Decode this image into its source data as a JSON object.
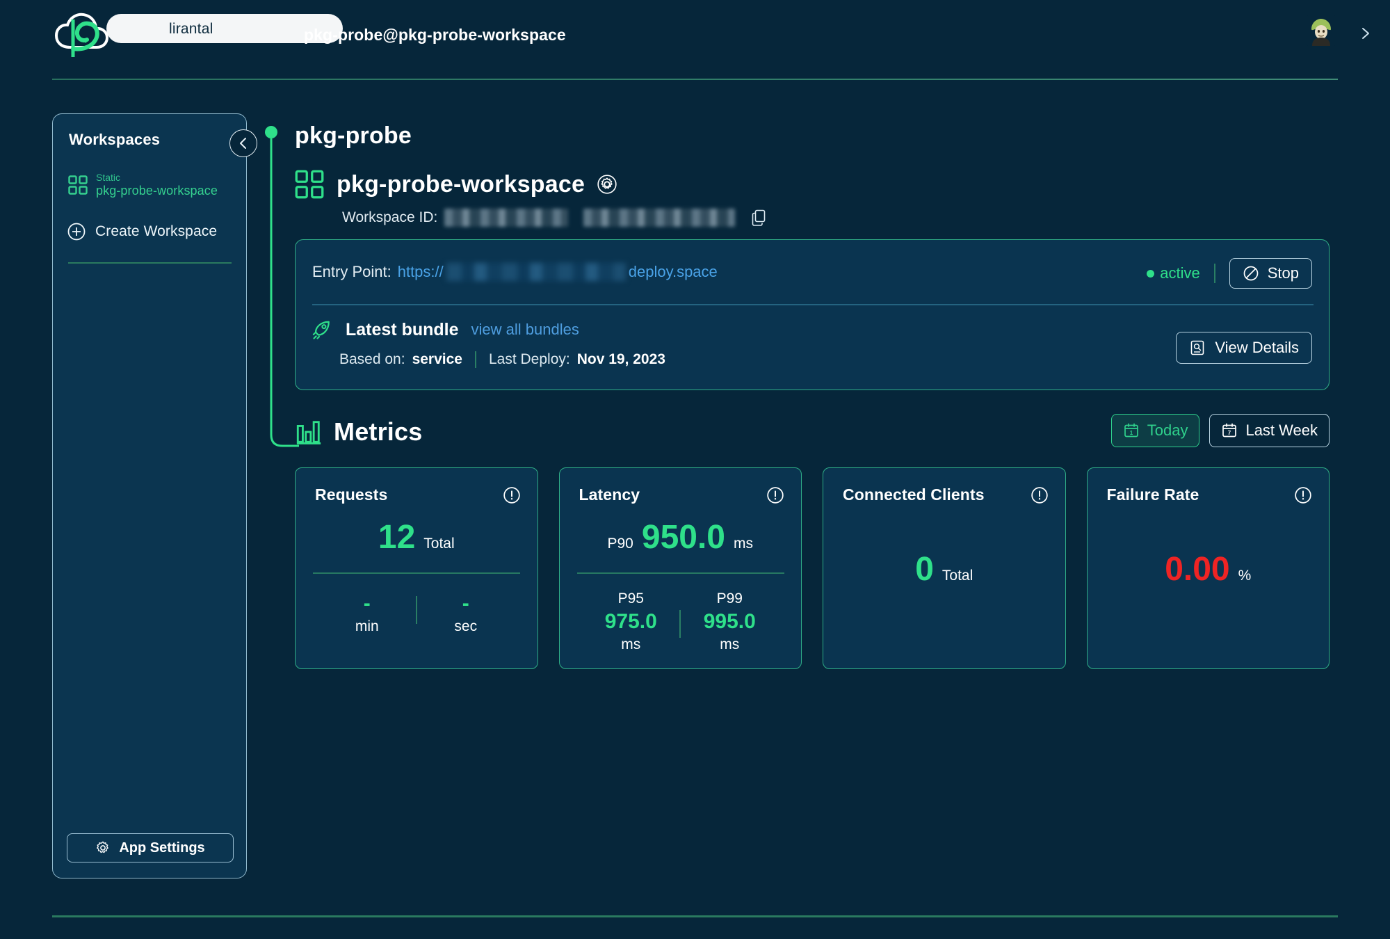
{
  "header": {
    "brand_name": "lirantal",
    "logo_icon": "cloud-p-logo",
    "title": "pkg-probe@pkg-probe-workspace",
    "avatar_icon": "user-avatar",
    "chevron_icon": "chevron-right-icon"
  },
  "sidebar": {
    "title": "Workspaces",
    "collapse_icon": "chevron-left-icon",
    "items": [
      {
        "kind": "Static",
        "name": "pkg-probe-workspace",
        "icon": "grid-squares-icon"
      }
    ],
    "create_label": "Create Workspace",
    "create_icon": "plus-circle-icon",
    "app_settings_label": "App Settings",
    "app_settings_icon": "gear-icon"
  },
  "main": {
    "project_title": "pkg-probe",
    "workspace_icon": "grid-squares-icon",
    "workspace_name": "pkg-probe-workspace",
    "workspace_settings_icon": "gear-icon",
    "workspace_id_label": "Workspace ID:",
    "workspace_id_value": "",
    "copy_icon": "copy-icon",
    "deploy": {
      "entry_point_label": "Entry Point:",
      "entry_point_scheme": "https://",
      "entry_point_host": "deploy.space",
      "status": "active",
      "stop_label": "Stop",
      "stop_icon": "no-entry-icon",
      "bundle_icon": "rocket-icon",
      "bundle_title": "Latest bundle",
      "bundle_link": "view all bundles",
      "based_on_label": "Based on:",
      "based_on_value": "service",
      "last_deploy_label": "Last Deploy:",
      "last_deploy_value": "Nov 19, 2023",
      "details_label": "View Details",
      "details_icon": "document-search-icon"
    },
    "metrics": {
      "title": "Metrics",
      "icon": "bar-chart-icon",
      "ranges": [
        {
          "label": "Today",
          "icon": "calendar-1-icon",
          "active": true
        },
        {
          "label": "Last Week",
          "icon": "calendar-7-icon",
          "active": false
        }
      ],
      "info_icon": "info-circle-icon",
      "cards": [
        {
          "title": "Requests",
          "primary_prefix": "",
          "primary_value": "12",
          "primary_unit": "Total",
          "primary_color": "#2fe08a",
          "has_divider": true,
          "sub": [
            {
              "key": "",
              "value": "-",
              "unit": "min"
            },
            {
              "key": "",
              "value": "-",
              "unit": "sec"
            }
          ]
        },
        {
          "title": "Latency",
          "primary_prefix": "P90",
          "primary_value": "950.0",
          "primary_unit": "ms",
          "primary_color": "#2fe08a",
          "has_divider": true,
          "sub": [
            {
              "key": "P95",
              "value": "975.0",
              "unit": "ms"
            },
            {
              "key": "P99",
              "value": "995.0",
              "unit": "ms"
            }
          ]
        },
        {
          "title": "Connected Clients",
          "primary_prefix": "",
          "primary_value": "0",
          "primary_unit": "Total",
          "primary_color": "#2fe08a",
          "has_divider": false,
          "sub": []
        },
        {
          "title": "Failure Rate",
          "primary_prefix": "",
          "primary_value": "0.00",
          "primary_unit": "%",
          "primary_color": "#ef2424",
          "has_divider": false,
          "sub": []
        }
      ]
    }
  },
  "colors": {
    "background": "#06263a",
    "panel": "#0a3450",
    "accent_green": "#2fe08a",
    "accent_border": "#2fae87",
    "link_blue": "#4f9ee0",
    "danger_red": "#ef2424"
  }
}
